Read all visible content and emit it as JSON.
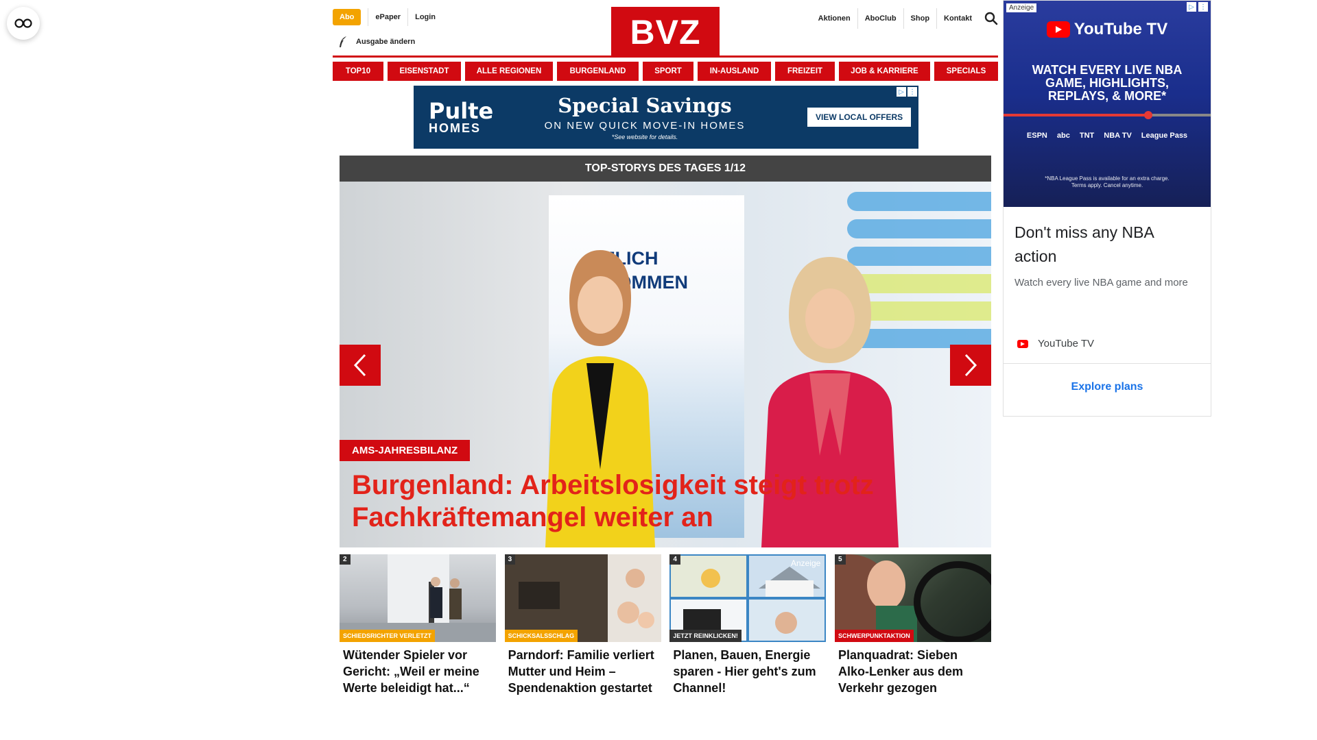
{
  "reader_button": {
    "icon": "glasses-icon"
  },
  "header": {
    "abo_label": "Abo",
    "left_links": [
      "ePaper",
      "Login"
    ],
    "edition_label": "Ausgabe ändern",
    "logo_text": "BVZ",
    "right_links": [
      "Aktionen",
      "AboClub",
      "Shop",
      "Kontakt"
    ],
    "search_icon": "search-icon"
  },
  "nav": {
    "items": [
      "TOP10",
      "EISENSTADT",
      "ALLE REGIONEN",
      "BURGENLAND",
      "SPORT",
      "IN-AUSLAND",
      "FREIZEIT",
      "JOB & KARRIERE",
      "SPECIALS"
    ]
  },
  "banner_ad": {
    "brand_line1": "Pulte",
    "brand_line2": "HOMES",
    "title": "Special Savings",
    "subtitle": "ON NEW QUICK MOVE-IN HOMES",
    "note": "*See website for details.",
    "cta": "VIEW LOCAL OFFERS"
  },
  "carousel": {
    "heading": "TOP-STORYS DES TAGES 1/12",
    "banner_text_line1": "ZLICH",
    "banner_text_line2": "KOMMEN",
    "tag": "AMS-JAHRESBILANZ",
    "title": "Burgenland: Arbeitslosigkeit steigt trotz Fachkräftemangel weiter an"
  },
  "teasers": [
    {
      "num": "2",
      "tag": "SCHIEDSRICHTER VERLETZT",
      "tag_color": "#f3a300",
      "title": "Wütender Spieler vor Gericht: „Weil er meine Werte beleidigt hat...“"
    },
    {
      "num": "3",
      "tag": "SCHICKSALSSCHLAG",
      "tag_color": "#f3a300",
      "title": "Parndorf: Familie verliert Mutter und Heim – Spendenaktion gestartet"
    },
    {
      "num": "4",
      "tag": "JETZT REINKLICKEN!",
      "tag_color": "#333333",
      "title": "Planen, Bauen, Energie sparen - Hier geht's zum Channel!",
      "ad_label": "Anzeige"
    },
    {
      "num": "5",
      "tag": "SCHWERPUNKTAKTION",
      "tag_color": "#d10a11",
      "title": "Planquadrat: Sieben Alko-Lenker aus dem Verkehr gezogen"
    }
  ],
  "side_ad": {
    "anzeige": "Anzeige",
    "logo_text": "YouTube TV",
    "headline": "WATCH EVERY LIVE NBA GAME, HIGHLIGHTS, REPLAYS, & MORE*",
    "progress": 0.7,
    "networks": [
      "ESPN",
      "abc",
      "TNT",
      "NBA TV",
      "League Pass"
    ],
    "fine_print": "*NBA League Pass is available for an extra charge. Terms apply. Cancel anytime.",
    "title": "Don't miss any NBA action",
    "description": "Watch every live NBA game and more",
    "brand": "YouTube TV",
    "cta": "Explore plans"
  },
  "colors": {
    "brand_red": "#d10a11",
    "abo_orange": "#f3a300",
    "headline_red": "#e2231a"
  }
}
